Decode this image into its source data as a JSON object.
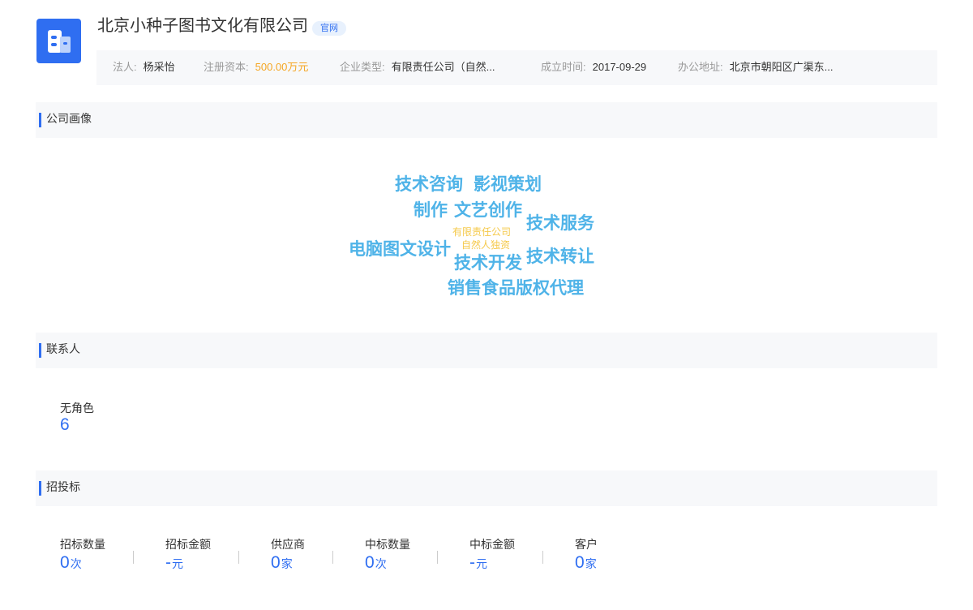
{
  "header": {
    "company_name": "北京小种子图书文化有限公司",
    "official_tag": "官网",
    "logo_icon": "building-icon",
    "accent_color": "#2f6ef1"
  },
  "info": {
    "legal_person_label": "法人:",
    "legal_person_value": "杨采怡",
    "capital_label": "注册资本:",
    "capital_value": "500.00万元",
    "type_label": "企业类型:",
    "type_value": "有限责任公司（自然...",
    "founded_label": "成立时间:",
    "founded_value": "2017-09-29",
    "address_label": "办公地址:",
    "address_value": "北京市朝阳区广渠东..."
  },
  "sections": {
    "portrait": "公司画像",
    "contacts": "联系人",
    "bidding": "招投标"
  },
  "wordcloud": {
    "words": [
      "技术咨询",
      "影视策划",
      "制作",
      "文艺创作",
      "技术服务",
      "有限责任公司",
      "自然人独资",
      "电脑图文设计",
      "技术开发",
      "技术转让",
      "销售食品版权代理"
    ]
  },
  "contacts": {
    "label": "无角色",
    "value": "6"
  },
  "bidding": {
    "stats": [
      {
        "label": "招标数量",
        "value": "0",
        "unit": "次"
      },
      {
        "label": "招标金额",
        "value": "-",
        "unit": "元"
      },
      {
        "label": "供应商",
        "value": "0",
        "unit": "家"
      },
      {
        "label": "中标数量",
        "value": "0",
        "unit": "次"
      },
      {
        "label": "中标金额",
        "value": "-",
        "unit": "元"
      },
      {
        "label": "客户",
        "value": "0",
        "unit": "家"
      }
    ]
  }
}
